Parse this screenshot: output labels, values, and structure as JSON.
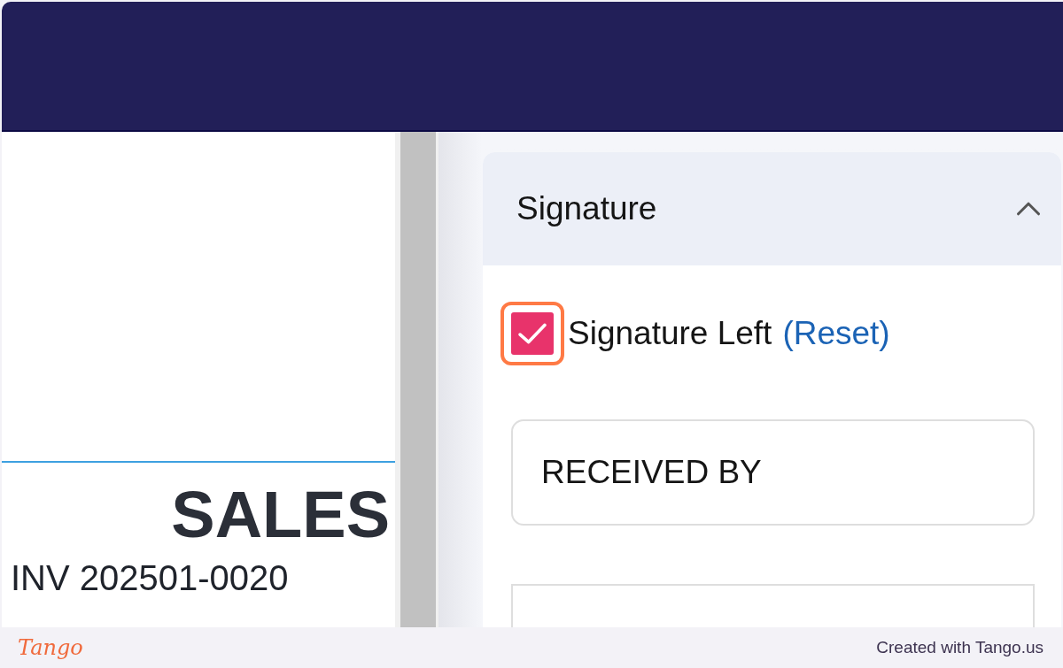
{
  "document": {
    "title": "SALES",
    "invoice_number": "INV 202501-0020"
  },
  "signature_section": {
    "title": "Signature",
    "expanded": true,
    "signature_left": {
      "label": "Signature Left",
      "link": "(Reset)",
      "checked": true,
      "highlighted": true
    },
    "fields": [
      {
        "value": "RECEIVED BY"
      }
    ]
  },
  "footer": {
    "logo": "Tango",
    "credit": "Created with Tango.us"
  }
}
